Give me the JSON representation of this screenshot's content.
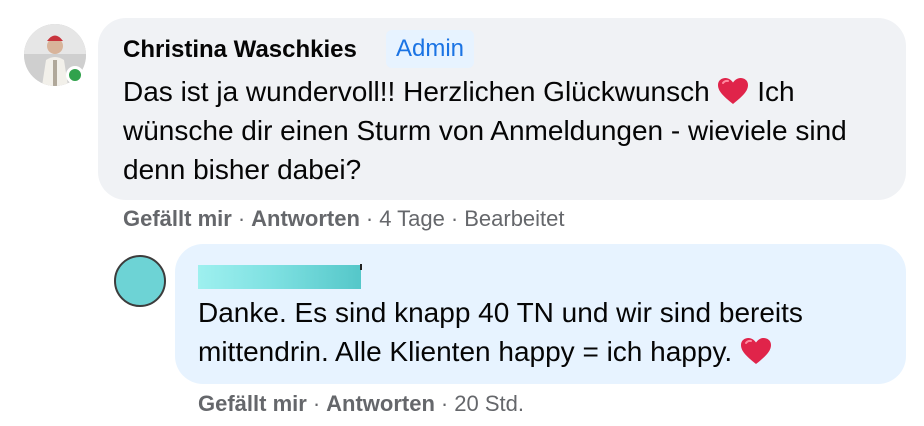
{
  "comment": {
    "author": "Christina Waschkies",
    "badge": "Admin",
    "text_part1": "Das ist ja wundervoll!! Herzlichen Glückwunsch",
    "text_part2": "Ich wünsche dir einen Sturm von Anmeldungen - wieviele sind denn bisher dabei?",
    "actions": {
      "like": "Gefällt mir",
      "reply": "Antworten",
      "time": "4 Tage",
      "edited": "Bearbeitet"
    },
    "online": true
  },
  "reply": {
    "text_part1": "Danke. Es sind knapp 40 TN und wir sind bereits mittendrin. Alle Klienten happy = ich happy.",
    "actions": {
      "like": "Gefällt mir",
      "reply": "Antworten",
      "time": "20 Std."
    }
  },
  "icons": [
    "heart-emoji-icon",
    "online-status-icon"
  ],
  "colors": {
    "comment_bubble": "#f0f2f5",
    "reply_bubble": "#e7f3ff",
    "badge_text": "#1b74e4",
    "meta_text": "#65676b",
    "online": "#31a24c",
    "heart": "#e0244a",
    "redaction": "#7fe1e2"
  }
}
